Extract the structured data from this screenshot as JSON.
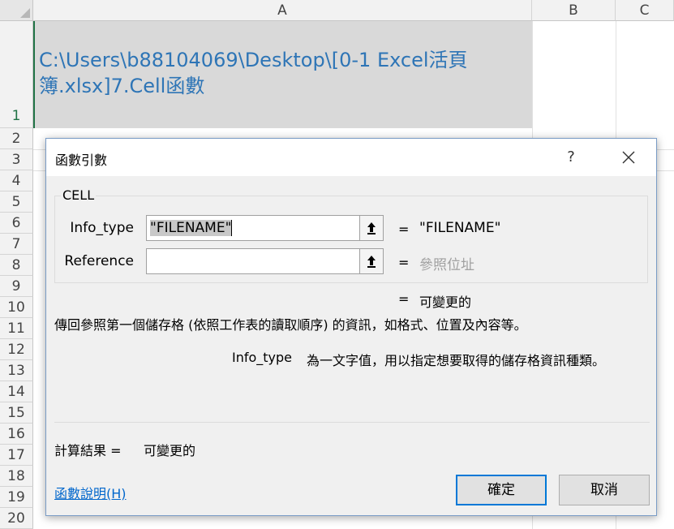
{
  "sheet": {
    "columns": [
      "A",
      "B",
      "C"
    ],
    "rows": [
      "1",
      "2",
      "3",
      "4",
      "5",
      "6",
      "7",
      "8",
      "9",
      "10",
      "11",
      "12",
      "13",
      "14",
      "15",
      "16",
      "17",
      "18",
      "19",
      "20"
    ],
    "cell_a1_line1": "C:\\Users\\b88104069\\Desktop\\[0-1 Excel活頁",
    "cell_a1_line2": "簿.xlsx]7.Cell函數",
    "cell_a1_color": "#2e75b6"
  },
  "dialog": {
    "title": "函數引數",
    "help_label": "?",
    "function_name": "CELL",
    "args": [
      {
        "label": "Info_type",
        "input_value": "\"FILENAME\"",
        "equals": "=",
        "result": "\"FILENAME\""
      },
      {
        "label": "Reference",
        "input_value": "",
        "equals": "=",
        "result": "參照位址"
      }
    ],
    "formula_result_equals": "=",
    "formula_result": "可變更的",
    "description": "傳回參照第一個儲存格 (依照工作表的讀取順序) 的資訊，如格式、位置及內容等。",
    "arg_desc_name": "Info_type",
    "arg_desc_text": "為一文字值，用以指定想要取得的儲存格資訊種類。",
    "calc_label": "計算結果 =",
    "calc_value": "可變更的",
    "help_link": "函數說明(H)",
    "ok_label": "確定",
    "cancel_label": "取消",
    "accent_color": "#0078d7"
  }
}
